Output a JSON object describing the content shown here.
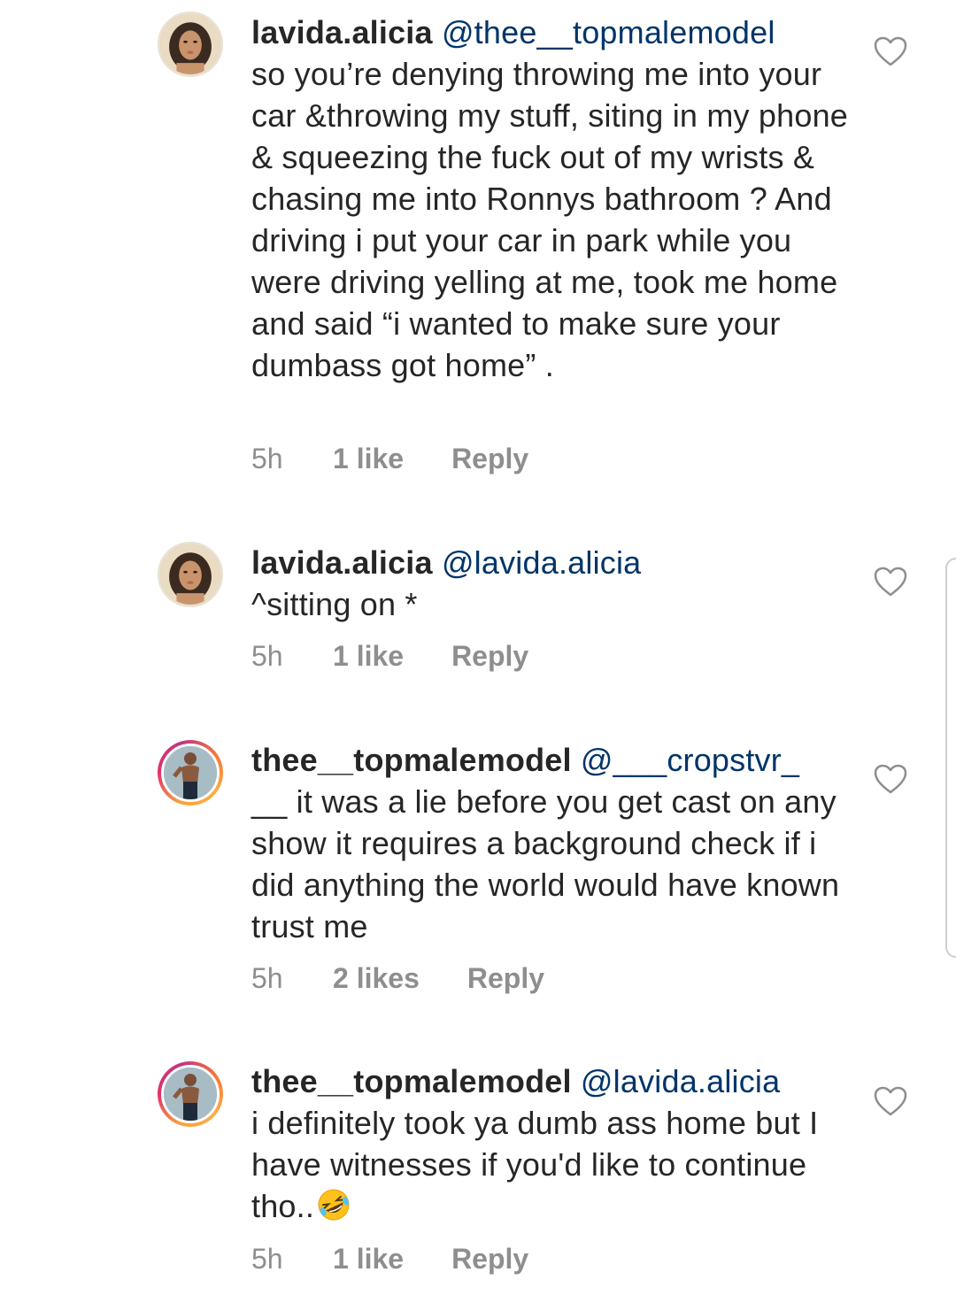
{
  "comments": [
    {
      "username": "lavida.alicia",
      "mention": "@thee__topmalemodel",
      "text": "so you’re denying throwing me into your car &throwing my stuff, siting in my phone & squeezing the fuck out of my wrists & chasing me into Ronnys bathroom ? And driving i put your car in park while you were driving yelling at me, took me home and said “i wanted to make sure your dumbass got home” .",
      "time": "5h",
      "likes": "1 like",
      "reply": "Reply",
      "avatar": "woman-avatar",
      "has_story_ring": false
    },
    {
      "username": "lavida.alicia",
      "mention": "@lavida.alicia",
      "text": "^sitting on *",
      "time": "5h",
      "likes": "1 like",
      "reply": "Reply",
      "avatar": "woman-avatar",
      "has_story_ring": false
    },
    {
      "username": "thee__topmalemodel",
      "mention": "@___cropstvr_",
      "text": "__ it was a lie before you get cast on any show it requires a background check if i did anything the world would have known trust me",
      "time": "5h",
      "likes": "2 likes",
      "reply": "Reply",
      "avatar": "man-avatar",
      "has_story_ring": true
    },
    {
      "username": "thee__topmalemodel",
      "mention": "@lavida.alicia",
      "text": "i definitely took ya dumb ass home but I have witnesses if you'd like to continue tho..",
      "emoji": "rolling-on-floor-laughing-emoji",
      "time": "5h",
      "likes": "1 like",
      "reply": "Reply",
      "avatar": "man-avatar",
      "has_story_ring": true
    }
  ],
  "colors": {
    "text": "#262626",
    "mention": "#003569",
    "meta": "#8e8e8e",
    "heart_outline": "#8e8e8e"
  }
}
